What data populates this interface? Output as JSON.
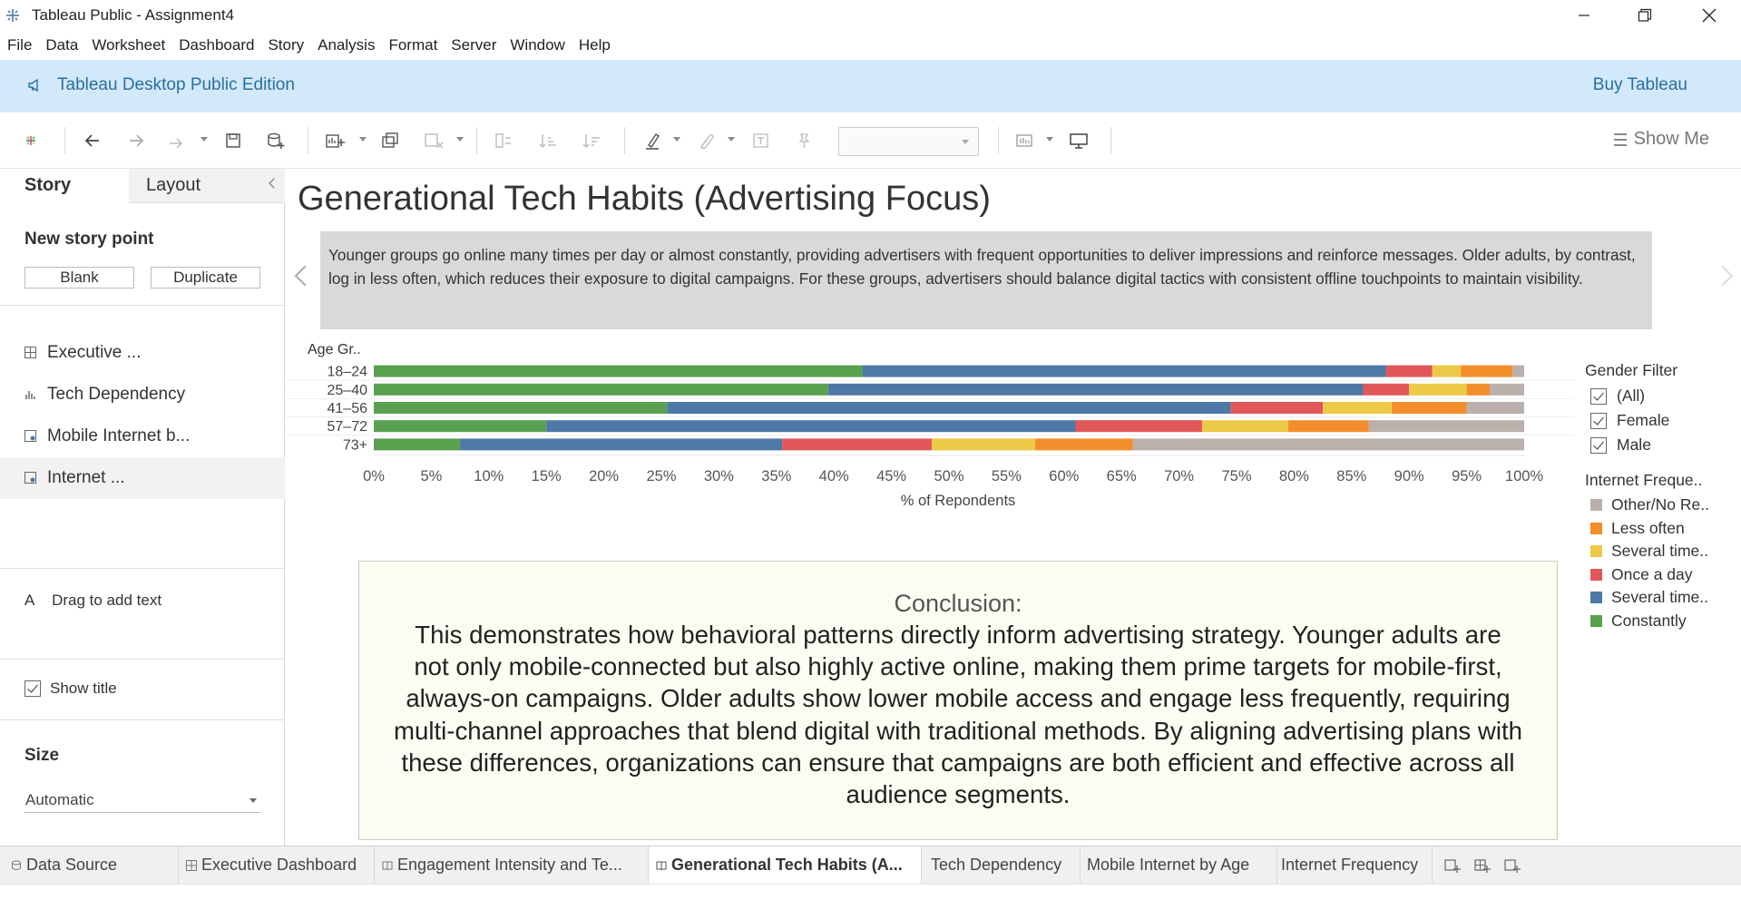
{
  "window": {
    "title": "Tableau Public - Assignment4"
  },
  "menu": [
    "File",
    "Data",
    "Worksheet",
    "Dashboard",
    "Story",
    "Analysis",
    "Format",
    "Server",
    "Window",
    "Help"
  ],
  "banner": {
    "edition": "Tableau Desktop Public Edition",
    "buy": "Buy Tableau"
  },
  "toolbar": {
    "show_me": "Show Me"
  },
  "left_panel": {
    "tab_story": "Story",
    "tab_layout": "Layout",
    "new_story_point": "New story point",
    "blank_button": "Blank",
    "duplicate_button": "Duplicate",
    "story_points": [
      {
        "label": "Executive ..."
      },
      {
        "label": "Tech Dependency"
      },
      {
        "label": "Mobile Internet b..."
      },
      {
        "label": "Internet ..."
      }
    ],
    "drag_text_icon": "A",
    "drag_text": "Drag to add text",
    "show_title": "Show title",
    "size_heading": "Size",
    "size_value": "Automatic"
  },
  "story": {
    "title": "Generational Tech Habits (Advertising Focus)",
    "caption": "Younger groups go online many times per day or almost constantly, providing advertisers with frequent opportunities to deliver impressions and reinforce messages. Older adults, by contrast, log in less often, which reduces their exposure to digital campaigns. For these groups, advertisers should balance digital tactics with consistent offline touchpoints to maintain visibility.",
    "conclusion_heading": "Conclusion:",
    "conclusion_lines": [
      "This demonstrates how behavioral patterns directly inform advertising strategy. Younger adults are",
      "not only mobile-connected but also highly active online, making them prime targets for mobile-first,",
      "always-on campaigns. Older adults show lower mobile access and engage less frequently, requiring",
      "multi-channel approaches that blend digital with traditional methods. By aligning advertising plans with",
      "these differences, organizations can ensure that campaigns are both efficient and effective across all",
      "audience segments."
    ]
  },
  "legend": {
    "gender_filter_title": "Gender Filter",
    "gender_options": [
      "(All)",
      "Female",
      "Male"
    ],
    "freq_title": "Internet Freque..",
    "freq_items": [
      {
        "label": "Other/No Re..",
        "color": "#bab0ac"
      },
      {
        "label": "Less often",
        "color": "#f28e2b"
      },
      {
        "label": "Several time..",
        "color": "#edc948"
      },
      {
        "label": "Once a day",
        "color": "#e15759"
      },
      {
        "label": "Several time..",
        "color": "#4e79a7"
      },
      {
        "label": "Constantly",
        "color": "#59a14f"
      }
    ]
  },
  "chart_data": {
    "type": "bar",
    "orientation": "horizontal",
    "stacked": true,
    "normalized_percent": true,
    "row_header": "Age Gr..",
    "xlabel": "% of Repondents",
    "xlim": [
      0,
      100
    ],
    "x_ticks": [
      "0%",
      "5%",
      "10%",
      "15%",
      "20%",
      "25%",
      "30%",
      "35%",
      "40%",
      "45%",
      "50%",
      "55%",
      "60%",
      "65%",
      "70%",
      "75%",
      "80%",
      "85%",
      "90%",
      "95%",
      "100%"
    ],
    "categories": [
      "18–24",
      "25–40",
      "41–56",
      "57–72",
      "73+"
    ],
    "series": [
      {
        "name": "Constantly",
        "color": "#59a14f",
        "values": [
          42.5,
          39.5,
          25.5,
          15.0,
          7.5
        ]
      },
      {
        "name": "Several time..",
        "color": "#4e79a7",
        "values": [
          45.5,
          46.5,
          49.0,
          46.0,
          28.0
        ]
      },
      {
        "name": "Once a day",
        "color": "#e15759",
        "values": [
          4.0,
          4.0,
          8.0,
          11.0,
          13.0
        ]
      },
      {
        "name": "Several time..",
        "color": "#edc948",
        "values": [
          2.5,
          5.0,
          6.0,
          7.5,
          9.0
        ]
      },
      {
        "name": "Less often",
        "color": "#f28e2b",
        "values": [
          4.5,
          2.0,
          6.5,
          7.0,
          8.5
        ]
      },
      {
        "name": "Other/No Re..",
        "color": "#bab0ac",
        "values": [
          1.0,
          3.0,
          5.0,
          13.5,
          34.0
        ]
      }
    ]
  },
  "sheet_tabs": [
    {
      "label": "Data Source",
      "active": false
    },
    {
      "label": "Executive Dashboard",
      "active": false
    },
    {
      "label": "Engagement Intensity and Te...",
      "active": false
    },
    {
      "label": "Generational Tech Habits (A...",
      "active": true
    },
    {
      "label": "Tech Dependency",
      "active": false
    },
    {
      "label": "Mobile Internet by Age",
      "active": false
    },
    {
      "label": "Internet Frequency",
      "active": false
    }
  ]
}
